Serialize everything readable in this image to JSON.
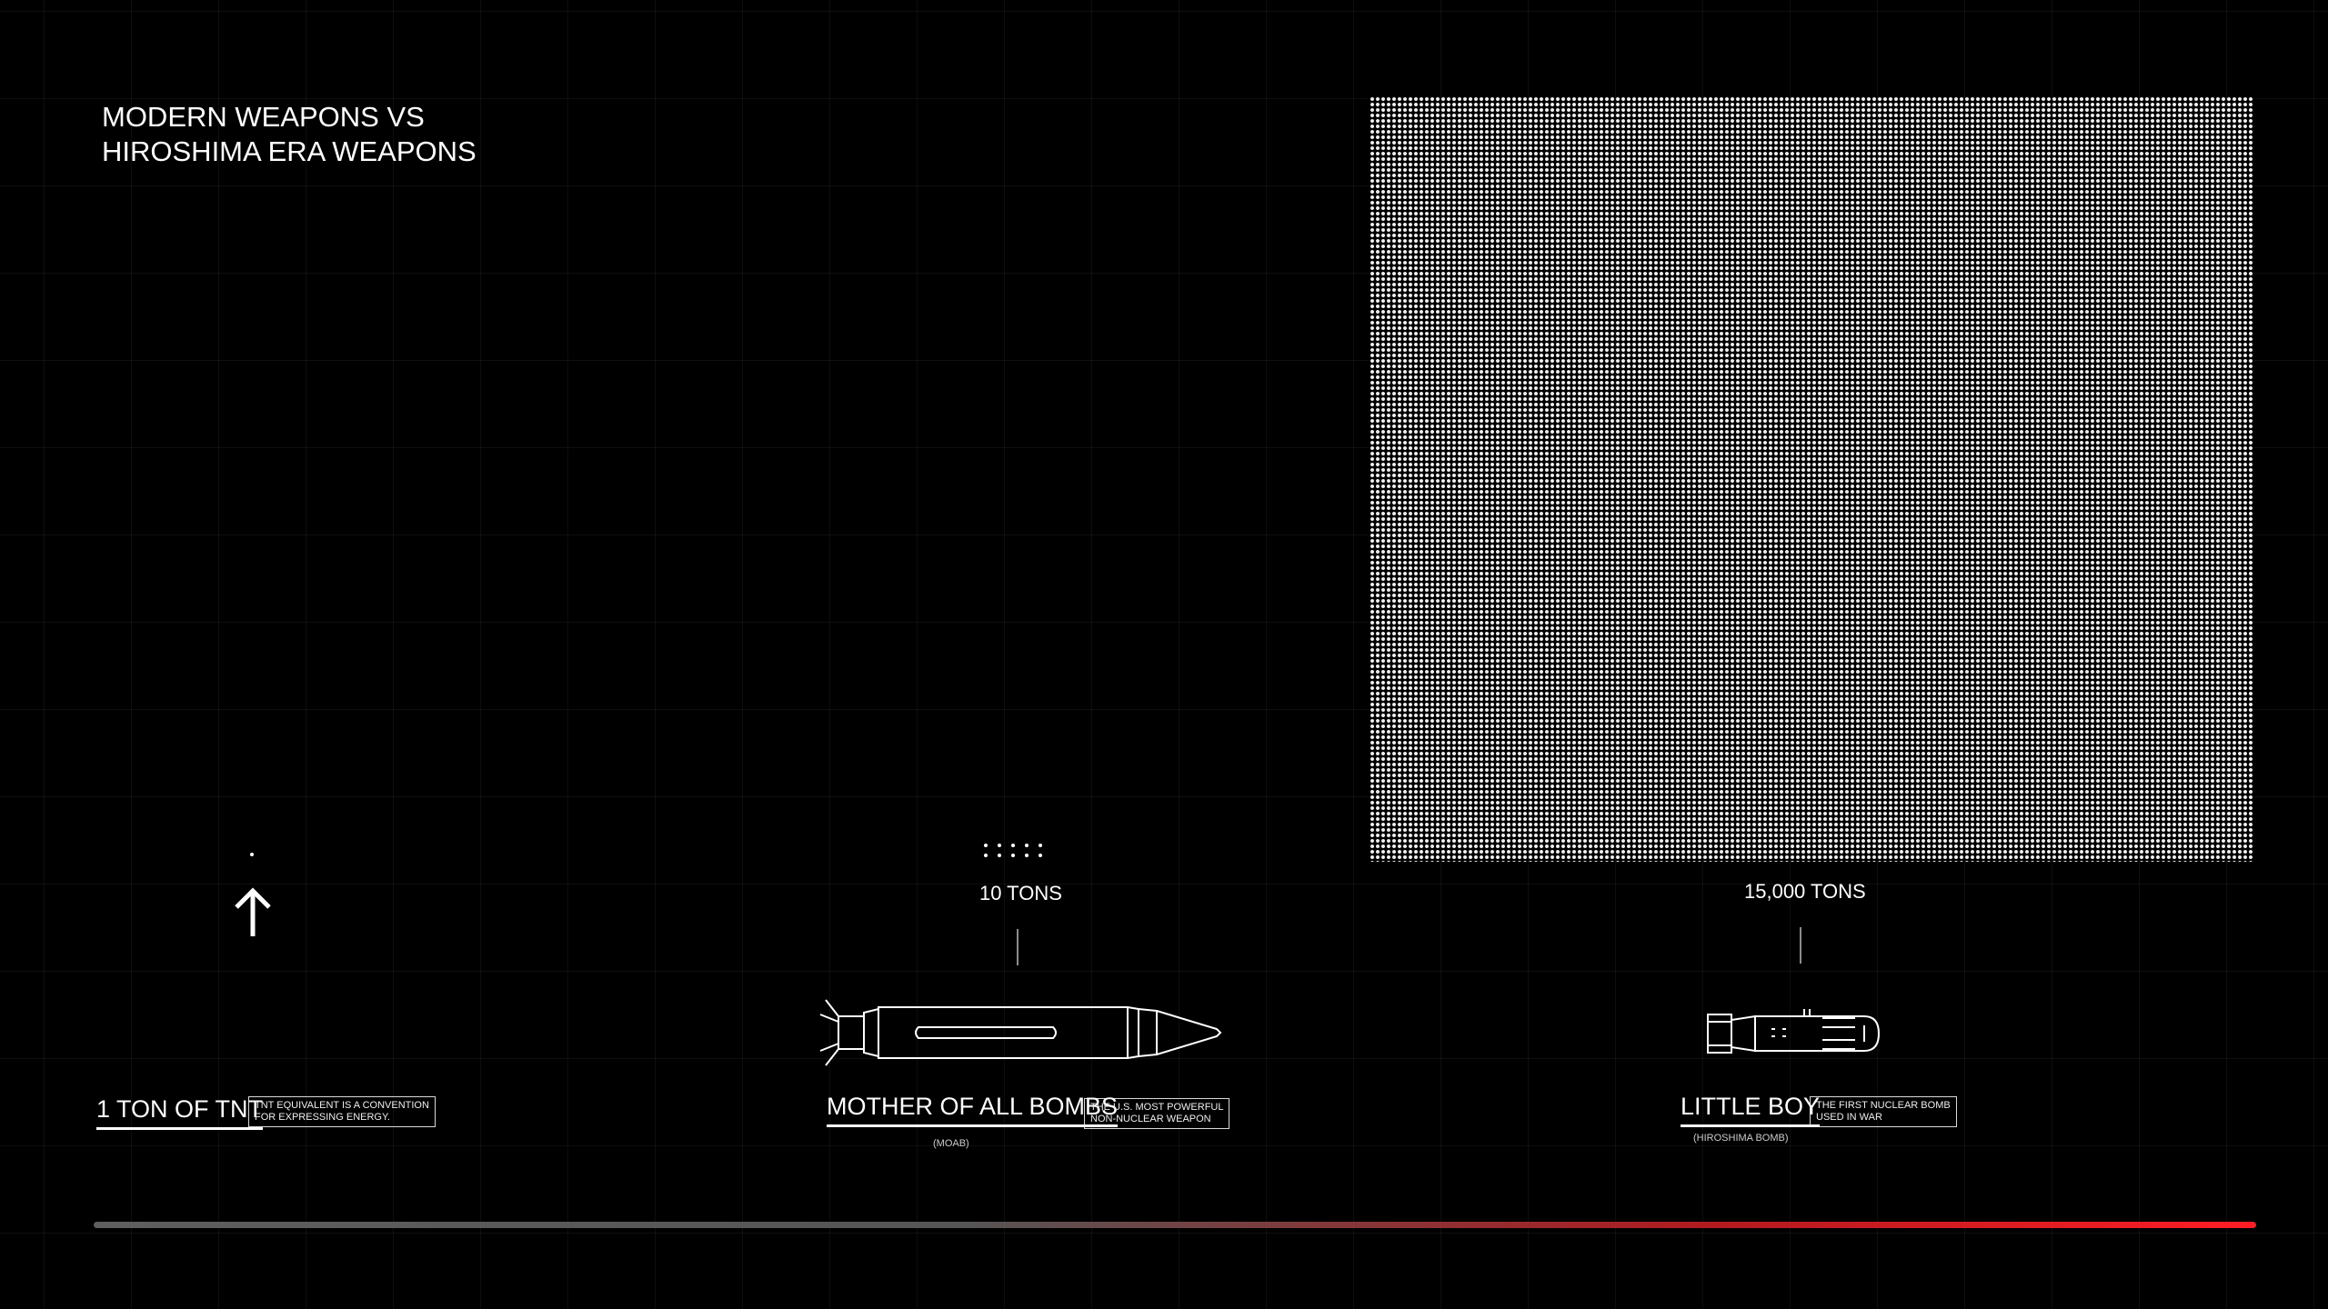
{
  "title": {
    "line1": "MODERN WEAPONS  VS",
    "line2": "HIROSHIMA ERA WEAPONS"
  },
  "weapons": [
    {
      "id": "tnt",
      "name": "1 TON OF TNT",
      "description_lines": [
        "TNT EQUIVALENT IS A CONVENTION",
        "FOR EXPRESSING ENERGY."
      ],
      "yield_tons": 1
    },
    {
      "id": "moab",
      "name": "MOTHER OF ALL BOMBS",
      "subtitle": "(MOAB)",
      "description_lines": [
        "THE U.S. MOST POWERFUL",
        "NON-NUCLEAR WEAPON"
      ],
      "yield_label": "10 TONS",
      "yield_tons": 10
    },
    {
      "id": "little-boy",
      "name": "LITTLE BOY",
      "subtitle": "(HIROSHIMA BOMB)",
      "description_lines": [
        "THE FIRST NUCLEAR BOMB",
        "USED IN WAR"
      ],
      "yield_label": "15,000 TONS",
      "yield_tons": 15000
    }
  ],
  "icons": {
    "arrow": "arrow-up-icon",
    "moab": "moab-bomb-icon",
    "little_boy": "little-boy-bomb-icon"
  },
  "colors": {
    "background": "#000000",
    "foreground": "#ffffff",
    "scale_start": "#5e5e5e",
    "scale_end": "#ff1d25"
  }
}
